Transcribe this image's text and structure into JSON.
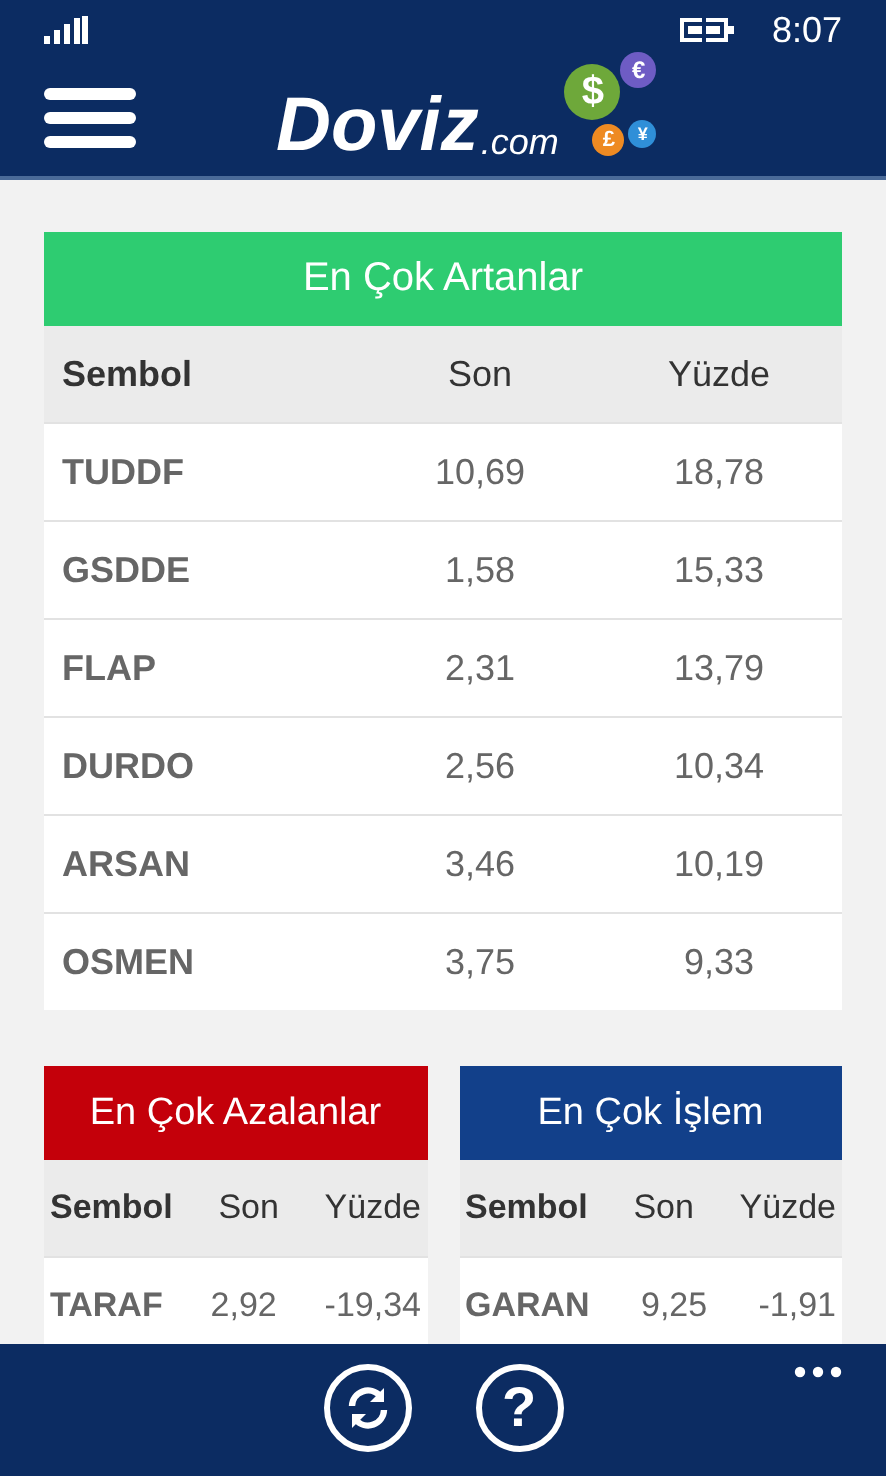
{
  "status_bar": {
    "time": "8:07"
  },
  "header": {
    "logo": {
      "name": "Doviz",
      "suffix": ".com",
      "coins": [
        {
          "symbol": "$",
          "color": "#6ea83a"
        },
        {
          "symbol": "€",
          "color": "#6e5cc4"
        },
        {
          "symbol": "£",
          "color": "#ee8a22"
        },
        {
          "symbol": "¥",
          "color": "#2f8fd8"
        }
      ]
    }
  },
  "sections": [
    {
      "title": "En Çok Artanlar",
      "color": "#2ecc71",
      "kind": "wide",
      "columns": [
        "Sembol",
        "Son",
        "Yüzde"
      ],
      "rows": [
        [
          "TUDDF",
          "10,69",
          "18,78"
        ],
        [
          "GSDDE",
          "1,58",
          "15,33"
        ],
        [
          "FLAP",
          "2,31",
          "13,79"
        ],
        [
          "DURDO",
          "2,56",
          "10,34"
        ],
        [
          "ARSAN",
          "3,46",
          "10,19"
        ],
        [
          "OSMEN",
          "3,75",
          "9,33"
        ]
      ]
    },
    {
      "title": "En Çok Azalanlar",
      "color": "#c4000a",
      "kind": "half",
      "columns": [
        "Sembol",
        "Son",
        "Yüzde"
      ],
      "rows": [
        [
          "TARAF",
          "2,92",
          "-19,34"
        ]
      ]
    },
    {
      "title": "En Çok İşlem",
      "color": "#12408a",
      "kind": "half",
      "columns": [
        "Sembol",
        "Son",
        "Yüzde"
      ],
      "rows": [
        [
          "GARAN",
          "9,25",
          "-1,91"
        ]
      ]
    }
  ],
  "app_bar": {
    "buttons": [
      {
        "kind": "refresh"
      },
      {
        "kind": "help",
        "label": "?"
      }
    ]
  }
}
